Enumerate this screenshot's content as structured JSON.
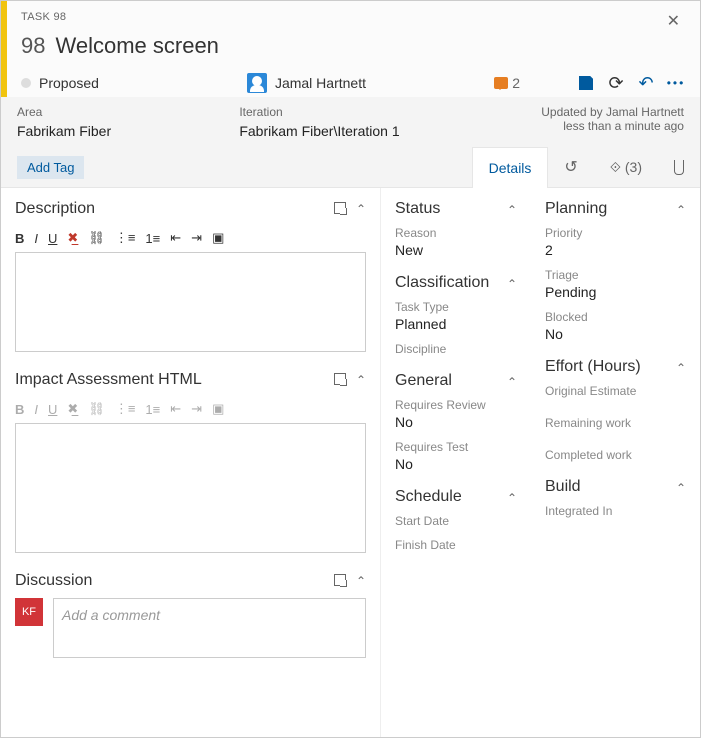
{
  "header": {
    "task_label": "TASK 98",
    "id": "98",
    "title": "Welcome screen",
    "state": "Proposed",
    "assignee": "Jamal Hartnett",
    "comment_count": "2"
  },
  "info": {
    "area_label": "Area",
    "area_value": "Fabrikam Fiber",
    "iteration_label": "Iteration",
    "iteration_value": "Fabrikam Fiber\\Iteration 1",
    "updated_by": "Updated by Jamal Hartnett",
    "updated_when": "less than a minute ago"
  },
  "tags": {
    "add_tag": "Add Tag"
  },
  "tabs": {
    "details": "Details",
    "links_count": "(3)"
  },
  "col1": {
    "description": "Description",
    "impact": "Impact Assessment HTML",
    "discussion": "Discussion",
    "comment_placeholder": "Add a comment",
    "disc_avatar": "KF"
  },
  "status": {
    "title": "Status",
    "reason_label": "Reason",
    "reason_value": "New"
  },
  "classification": {
    "title": "Classification",
    "tasktype_label": "Task Type",
    "tasktype_value": "Planned",
    "discipline_label": "Discipline"
  },
  "general": {
    "title": "General",
    "review_label": "Requires Review",
    "review_value": "No",
    "test_label": "Requires Test",
    "test_value": "No"
  },
  "schedule": {
    "title": "Schedule",
    "start_label": "Start Date",
    "finish_label": "Finish Date"
  },
  "planning": {
    "title": "Planning",
    "priority_label": "Priority",
    "priority_value": "2",
    "triage_label": "Triage",
    "triage_value": "Pending",
    "blocked_label": "Blocked",
    "blocked_value": "No"
  },
  "effort": {
    "title": "Effort (Hours)",
    "orig_label": "Original Estimate",
    "remain_label": "Remaining work",
    "compl_label": "Completed work"
  },
  "build": {
    "title": "Build",
    "integrated_label": "Integrated In"
  }
}
